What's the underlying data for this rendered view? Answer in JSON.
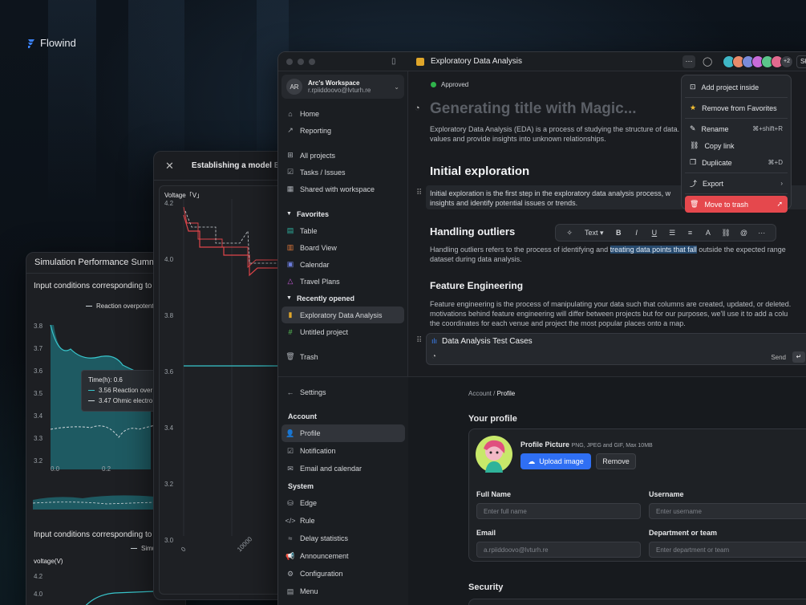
{
  "brand": {
    "name": "Flowind"
  },
  "simulation": {
    "title": "Simulation Performance Summary I",
    "subtitle1": "Input conditions corresponding to t",
    "subtitle2": "Input conditions corresponding to t",
    "legend1": "Reaction overpotent",
    "legend2": "Simu",
    "ylabel2": "voltage(V)",
    "tooltip": {
      "time": "Time(h): 0.6",
      "r1": "3.56 Reaction over",
      "r2": "3.47 Ohmic electro"
    }
  },
  "model": {
    "title": "Establishing a model",
    "title_extra": "Ba",
    "ylabel": "Voltage「V」"
  },
  "app": {
    "doc_title": "Exploratory Data Analysis",
    "avatar_more": "+2",
    "share_short": "Sł",
    "workspace": {
      "initials": "AR",
      "name": "Arc's Workspace",
      "email": "r.rpiiddoovo@lvturh.re"
    },
    "nav": [
      "Home",
      "Reporting",
      "All projects",
      "Tasks / Issues",
      "Shared with workspace"
    ],
    "favorites_label": "Favorites",
    "favorites": [
      "Table",
      "Board View",
      "Calendar",
      "Travel Plans"
    ],
    "recent_label": "Recently opened",
    "recent": [
      "Exploratory Data Analysis",
      "Untitled project"
    ],
    "trash": "Trash"
  },
  "doc": {
    "status": "Approved",
    "magic_title": "Generating title with Magic...",
    "intro1": "Exploratory Data Analysis (EDA) is a process of studying the structure of data. By explori",
    "intro2": "values and provide insights into unknown relationships.",
    "h_initial": "Initial exploration",
    "p_initial1": "Initial exploration is the first step in the exploratory data analysis process, w",
    "p_initial2": "insights and identify potential issues or trends.",
    "h_outliers": "Handling outliers",
    "p_out1a": "Handling outliers refers to the process of identifying and ",
    "p_out1hl": "treating data points that fall",
    "p_out1b": " outside the expected range",
    "p_out2": "dataset during data analysis.",
    "h_feature": "Feature Engineering",
    "p_feat1": "Feature engineering is the process of manipulating your data such that columns are created, updated, or deleted.",
    "p_feat2": "motivations behind feature engineering will differ between projects but for our purposes, we'll use it to add a colu",
    "p_feat3": "the coordinates for each venue and project the most popular places onto a map.",
    "prompt_text": "Data Analysis Test Cases",
    "send": "Send",
    "toolbar_text": "Text"
  },
  "menu": {
    "items": [
      {
        "label": "Add project inside"
      },
      {
        "label": "Remove from Favorites"
      },
      {
        "label": "Rename",
        "key": "⌘+shift+R"
      },
      {
        "label": "Copy link"
      },
      {
        "label": "Duplicate",
        "key": "⌘+D"
      },
      {
        "label": "Export"
      },
      {
        "label": "Move to trash"
      }
    ]
  },
  "settings": {
    "back": "Settings",
    "account_label": "Account",
    "account_items": [
      "Profile",
      "Notification",
      "Email and calendar"
    ],
    "system_label": "System",
    "system_items": [
      "Edge",
      "Rule",
      "Delay statistics",
      "Announcement",
      "Configuration",
      "Menu"
    ],
    "crumb_parent": "Account",
    "crumb_current": "Profile",
    "your_profile": "Your profile",
    "picture_label": "Profile Picture",
    "picture_hint": "PNG, JPEG and GIF, Max 10MB",
    "upload": "Upload image",
    "remove": "Remove",
    "full_name": "Full Name",
    "full_name_ph": "Enter full name",
    "username": "Username",
    "username_ph": "Enter username",
    "email": "Email",
    "email_value": "a.rpiiddoovo@lvturh.re",
    "dept": "Department or team",
    "dept_ph": "Enter department or team",
    "security": "Security"
  },
  "charts": {
    "sim_y_ticks": [
      "3.8",
      "3.7",
      "3.6",
      "3.5",
      "3.4",
      "3.3",
      "3.2"
    ],
    "sim_x_ticks": [
      "0.0",
      "0.2"
    ],
    "sim2_y_ticks": [
      "4.2",
      "4.0"
    ],
    "model_y_ticks": [
      "4.2",
      "4.0",
      "3.8",
      "3.6",
      "3.4",
      "3.2",
      "3.0"
    ],
    "model_x_ticks": [
      "0",
      "10000"
    ]
  },
  "colors": {
    "accent": "#2f6ff3",
    "danger": "#e5484d",
    "teal": "#2ab3b8",
    "approved": "#2fb34b",
    "red_line": "#e0454a"
  }
}
